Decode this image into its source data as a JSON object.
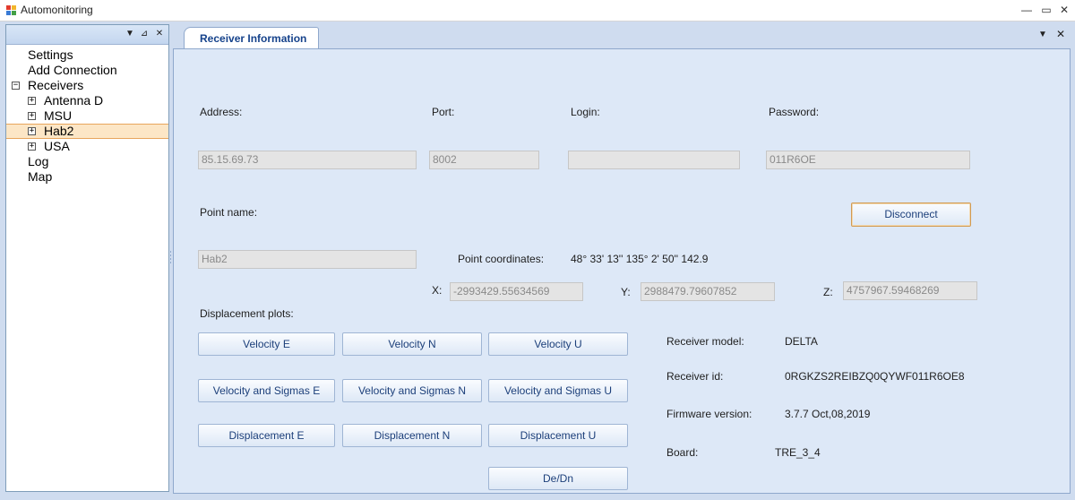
{
  "window": {
    "title": "Automonitoring",
    "controls": {
      "minimize": "—",
      "maximize": "▭",
      "close": "✕"
    }
  },
  "left_pane": {
    "controls": {
      "menu": "▼",
      "pin": "⊿",
      "close": "✕"
    },
    "tree": [
      {
        "label": "Settings",
        "level": 0,
        "expander": ""
      },
      {
        "label": "Add Connection",
        "level": 0,
        "expander": ""
      },
      {
        "label": "Receivers",
        "level": 0,
        "expander": "−"
      },
      {
        "label": "Antenna D",
        "level": 1,
        "expander": "+"
      },
      {
        "label": "MSU",
        "level": 1,
        "expander": "+"
      },
      {
        "label": "Hab2",
        "level": 1,
        "expander": "+",
        "selected": true
      },
      {
        "label": "USA",
        "level": 1,
        "expander": "+"
      },
      {
        "label": "Log",
        "level": 0,
        "expander": ""
      },
      {
        "label": "Map",
        "level": 0,
        "expander": ""
      }
    ]
  },
  "tab": {
    "label": "Receiver Information",
    "menu_glyph": "▼",
    "close_glyph": "✕"
  },
  "connection": {
    "address_label": "Address:",
    "address_value": "85.15.69.73",
    "port_label": "Port:",
    "port_value": "8002",
    "login_label": "Login:",
    "login_value": "",
    "password_label": "Password:",
    "password_value": "011R6OE",
    "disconnect_label": "Disconnect"
  },
  "point": {
    "name_label": "Point name:",
    "name_value": "Hab2",
    "coordinates_label": "Point coordinates:",
    "coordinates_value": "48° 33' 13'' 135° 2' 50'' 142.9",
    "x_label": "X:",
    "x_value": "-2993429.55634569",
    "y_label": "Y:",
    "y_value": "2988479.79607852",
    "z_label": "Z:",
    "z_value": "4757967.59468269"
  },
  "plots": {
    "label": "Displacement plots:",
    "velocity_e": "Velocity E",
    "velocity_n": "Velocity N",
    "velocity_u": "Velocity U",
    "vsigmas_e": "Velocity and Sigmas E",
    "vsigmas_n": "Velocity and Sigmas N",
    "vsigmas_u": "Velocity and Sigmas U",
    "displacement_e": "Displacement E",
    "displacement_n": "Displacement N",
    "displacement_u": "Displacement U",
    "dedn": "De/Dn"
  },
  "receiver": {
    "model_label": "Receiver model:",
    "model_value": "DELTA",
    "id_label": "Receiver id:",
    "id_value": "0RGKZS2REIBZQ0QYWF011R6OE8",
    "firmware_label": "Firmware version:",
    "firmware_value": "3.7.7 Oct,08,2019",
    "board_label": "Board:",
    "board_value": "TRE_3_4"
  },
  "colors": {
    "accent": "#15428b",
    "selection_fill": "#fce6c6",
    "selection_border": "#e8a55c",
    "content_bg": "#dde8f7"
  }
}
